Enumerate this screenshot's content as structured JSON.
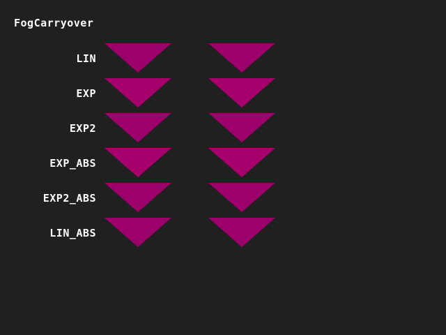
{
  "app": {
    "title": "FogCarryover"
  },
  "colors": {
    "background": "#202020",
    "text": "#ffffff",
    "triangle_a": "#9c006a",
    "triangle_b": "#a6006c"
  },
  "rows": [
    {
      "label": "LIN",
      "left_color": "#9c006a",
      "right_color": "#9c006a"
    },
    {
      "label": "EXP",
      "left_color": "#a6006c",
      "right_color": "#a6006c"
    },
    {
      "label": "EXP2",
      "left_color": "#9c006a",
      "right_color": "#9c006a"
    },
    {
      "label": "EXP_ABS",
      "left_color": "#a6006c",
      "right_color": "#a6006c"
    },
    {
      "label": "EXP2_ABS",
      "left_color": "#9c006a",
      "right_color": "#9c006a"
    },
    {
      "label": "LIN_ABS",
      "left_color": "#9c006a",
      "right_color": "#9c006a"
    }
  ]
}
